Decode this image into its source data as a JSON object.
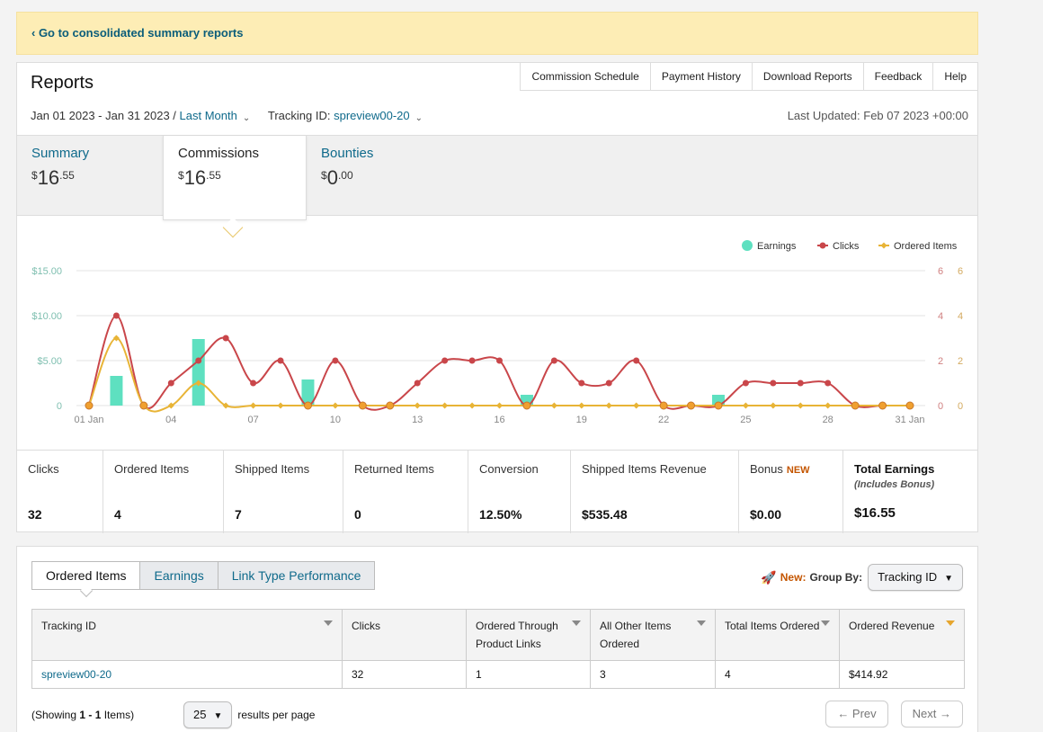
{
  "banner": {
    "link": "‹ Go to consolidated summary reports"
  },
  "header": {
    "title": "Reports",
    "nav": [
      "Commission Schedule",
      "Payment History",
      "Download Reports",
      "Feedback",
      "Help"
    ],
    "date_range": "Jan 01 2023 - Jan 31 2023 /",
    "period": "Last Month",
    "tracking_label": "Tracking ID:",
    "tracking_id": "spreview00-20",
    "last_updated": "Last Updated: Feb 07 2023 +00:00"
  },
  "summary_tabs": [
    {
      "label": "Summary",
      "dollar": "$",
      "whole": "16",
      "cents": ".55"
    },
    {
      "label": "Commissions",
      "dollar": "$",
      "whole": "16",
      "cents": ".55"
    },
    {
      "label": "Bounties",
      "dollar": "$",
      "whole": "0",
      "cents": ".00"
    }
  ],
  "colors": {
    "earnings": "#5ee0c0",
    "clicks": "#c9464a",
    "ordered": "#e8b436",
    "link": "#0f6a8b"
  },
  "chart_data": {
    "type": "line",
    "legend": [
      "Earnings",
      "Clicks",
      "Ordered Items"
    ],
    "legend_position": "top-right",
    "x_ticks": [
      "01 Jan",
      "04",
      "07",
      "10",
      "13",
      "16",
      "19",
      "22",
      "25",
      "28",
      "31 Jan"
    ],
    "y_left_ticks": [
      "0",
      "$5.00",
      "$10.00",
      "$15.00"
    ],
    "y_right_ticks": [
      "0",
      "2",
      "4",
      "6"
    ],
    "y_left_range": [
      0,
      15
    ],
    "y_right_range": [
      0,
      6
    ],
    "days": [
      1,
      2,
      3,
      4,
      5,
      6,
      7,
      8,
      9,
      10,
      11,
      12,
      13,
      14,
      15,
      16,
      17,
      18,
      19,
      20,
      21,
      22,
      23,
      24,
      25,
      26,
      27,
      28,
      29,
      30,
      31
    ],
    "series": [
      {
        "name": "Earnings",
        "kind": "bar",
        "axis": "left",
        "values": [
          0,
          3.3,
          0,
          0,
          7.4,
          0,
          0,
          0,
          2.9,
          0,
          0,
          0,
          0,
          0,
          0,
          0,
          1.2,
          0,
          0,
          0,
          0,
          0,
          0,
          1.2,
          0,
          0,
          0,
          0,
          0,
          0,
          0
        ]
      },
      {
        "name": "Clicks",
        "kind": "line",
        "axis": "right",
        "values": [
          0,
          4,
          0,
          1,
          2,
          3,
          1,
          2,
          0,
          2,
          0,
          0,
          1,
          2,
          2,
          2,
          0,
          2,
          1,
          1,
          2,
          0,
          0,
          0,
          1,
          1,
          1,
          1,
          0,
          0,
          0
        ]
      },
      {
        "name": "Ordered Items",
        "kind": "line",
        "axis": "right",
        "values": [
          0,
          3,
          0,
          0,
          1,
          0,
          0,
          0,
          0,
          0,
          0,
          0,
          0,
          0,
          0,
          0,
          0,
          0,
          0,
          0,
          0,
          0,
          0,
          0,
          0,
          0,
          0,
          0,
          0,
          0,
          0
        ]
      }
    ],
    "grid": true
  },
  "stats": [
    {
      "label": "Clicks",
      "value": "32"
    },
    {
      "label": "Ordered Items",
      "value": "4"
    },
    {
      "label": "Shipped Items",
      "value": "7"
    },
    {
      "label": "Returned Items",
      "value": "0"
    },
    {
      "label": "Conversion",
      "value": "12.50%"
    },
    {
      "label": "Shipped Items Revenue",
      "value": "$535.48"
    },
    {
      "label": "Bonus",
      "badge": "NEW",
      "value": "$0.00"
    },
    {
      "label": "Total Earnings",
      "sub": "(Includes Bonus)",
      "value": "$16.55"
    }
  ],
  "report": {
    "tabs": [
      "Ordered Items",
      "Earnings",
      "Link Type Performance"
    ],
    "new_label": "New:",
    "group_by_label": "Group By:",
    "group_by_value": "Tracking ID",
    "columns": [
      "Tracking ID",
      "Clicks",
      "Ordered Through Product Links",
      "All Other Items Ordered",
      "Total Items Ordered",
      "Ordered Revenue"
    ],
    "rows": [
      [
        "spreview00-20",
        "32",
        "1",
        "3",
        "4",
        "$414.92"
      ]
    ],
    "showing_prefix": "(Showing ",
    "showing_range": "1 - 1",
    "showing_suffix": " Items)",
    "per_page": "25",
    "per_page_label": "results per page",
    "prev": "← Prev",
    "next": "Next →"
  }
}
